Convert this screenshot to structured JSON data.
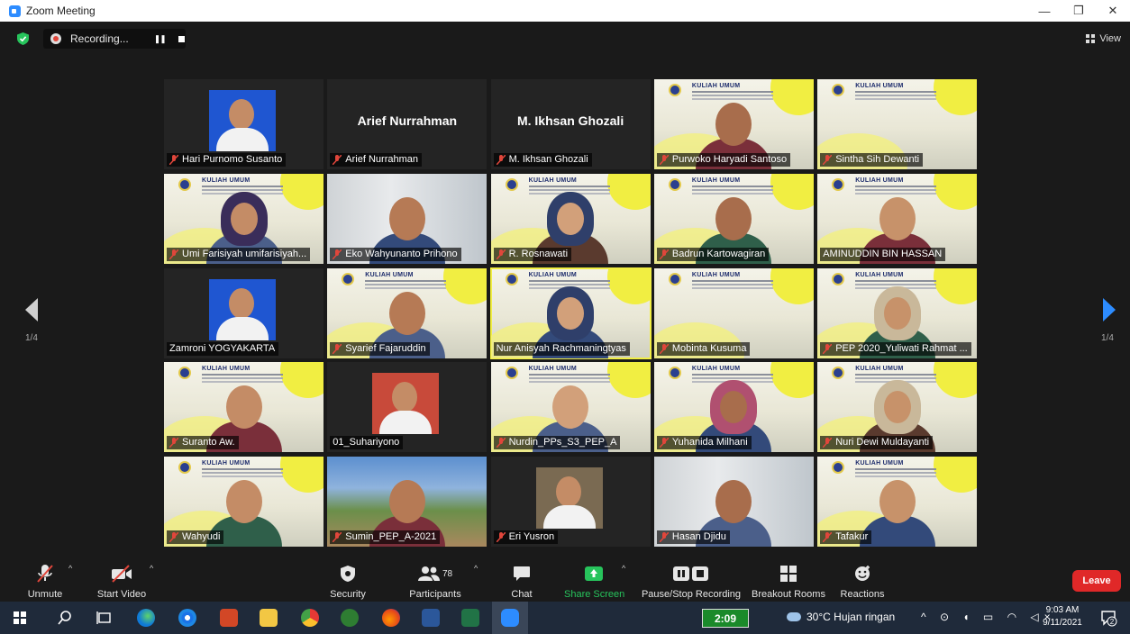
{
  "window": {
    "title": "Zoom Meeting",
    "controls": {
      "minimize": "—",
      "restore": "❐",
      "close": "✕"
    }
  },
  "topbar": {
    "recording_label": "Recording...",
    "view_label": "View"
  },
  "gallery": {
    "page_left": "1/4",
    "page_right": "1/4",
    "kuliah_banner": "KULIAH UMUM",
    "participants": [
      {
        "name": "Hari Purnomo Susanto",
        "muted": true,
        "kind": "photo"
      },
      {
        "name": "Arief Nurrahman",
        "muted": true,
        "kind": "name",
        "display_name": "Arief Nurrahman"
      },
      {
        "name": "M. Ikhsan Ghozali",
        "muted": true,
        "kind": "name",
        "display_name": "M. Ikhsan Ghozali"
      },
      {
        "name": "Purwoko Haryadi Santoso",
        "muted": true,
        "kind": "video-kuliah"
      },
      {
        "name": "Sintha Sih Dewanti",
        "muted": true,
        "kind": "kuliah"
      },
      {
        "name": "Umi Farisiyah umifarisiyah...",
        "muted": true,
        "kind": "video-kuliah-hijab"
      },
      {
        "name": "Eko Wahyunanto Prihono",
        "muted": true,
        "kind": "video-room"
      },
      {
        "name": "R. Rosnawati",
        "muted": true,
        "kind": "video-kuliah-hijab"
      },
      {
        "name": "Badrun Kartowagiran",
        "muted": true,
        "kind": "video-kuliah"
      },
      {
        "name": "AMINUDDIN BIN HASSAN",
        "muted": false,
        "kind": "video-kuliah"
      },
      {
        "name": "Zamroni YOGYAKARTA",
        "muted": false,
        "kind": "photo"
      },
      {
        "name": "Syarief Fajaruddin",
        "muted": true,
        "kind": "video-kuliah"
      },
      {
        "name": "Nur Anisyah Rachmaningtyas",
        "muted": false,
        "kind": "video-kuliah-hijab",
        "active": true
      },
      {
        "name": "Mobinta Kusuma",
        "muted": true,
        "kind": "kuliah"
      },
      {
        "name": "PEP 2020_Yuliwati Rahmat ...",
        "muted": true,
        "kind": "video-kuliah-hijab"
      },
      {
        "name": "Suranto Aw.",
        "muted": true,
        "kind": "video-kuliah"
      },
      {
        "name": "01_Suhariyono",
        "muted": false,
        "kind": "photo"
      },
      {
        "name": "Nurdin_PPs_S3_PEP_A",
        "muted": true,
        "kind": "video-kuliah"
      },
      {
        "name": "Yuhanida Milhani",
        "muted": true,
        "kind": "video-kuliah-hijab"
      },
      {
        "name": "Nuri Dewi Muldayanti",
        "muted": true,
        "kind": "video-kuliah-hijab"
      },
      {
        "name": "Wahyudi",
        "muted": true,
        "kind": "video-kuliah"
      },
      {
        "name": "Sumin_PEP_A-2021",
        "muted": true,
        "kind": "video-landscape"
      },
      {
        "name": "Eri Yusron",
        "muted": true,
        "kind": "photo"
      },
      {
        "name": "Hasan Djidu",
        "muted": true,
        "kind": "video-room"
      },
      {
        "name": "Tafakur",
        "muted": true,
        "kind": "video-kuliah"
      }
    ]
  },
  "toolbar": {
    "unmute": "Unmute",
    "start_video": "Start Video",
    "security": "Security",
    "participants": "Participants",
    "participants_count": "78",
    "chat": "Chat",
    "share_screen": "Share Screen",
    "pause_stop_recording": "Pause/Stop Recording",
    "breakout_rooms": "Breakout Rooms",
    "reactions": "Reactions",
    "leave": "Leave"
  },
  "taskbar": {
    "timer": "2:09",
    "weather": "30°C  Hujan ringan",
    "time": "9:03 AM",
    "date": "9/11/2021",
    "notifications": "2"
  },
  "colors": {
    "accent_blue": "#2d8cff",
    "active_speaker": "#f1ee42",
    "leave_red": "#e02828",
    "share_green": "#27c45c",
    "muted_red": "#e0463b"
  }
}
